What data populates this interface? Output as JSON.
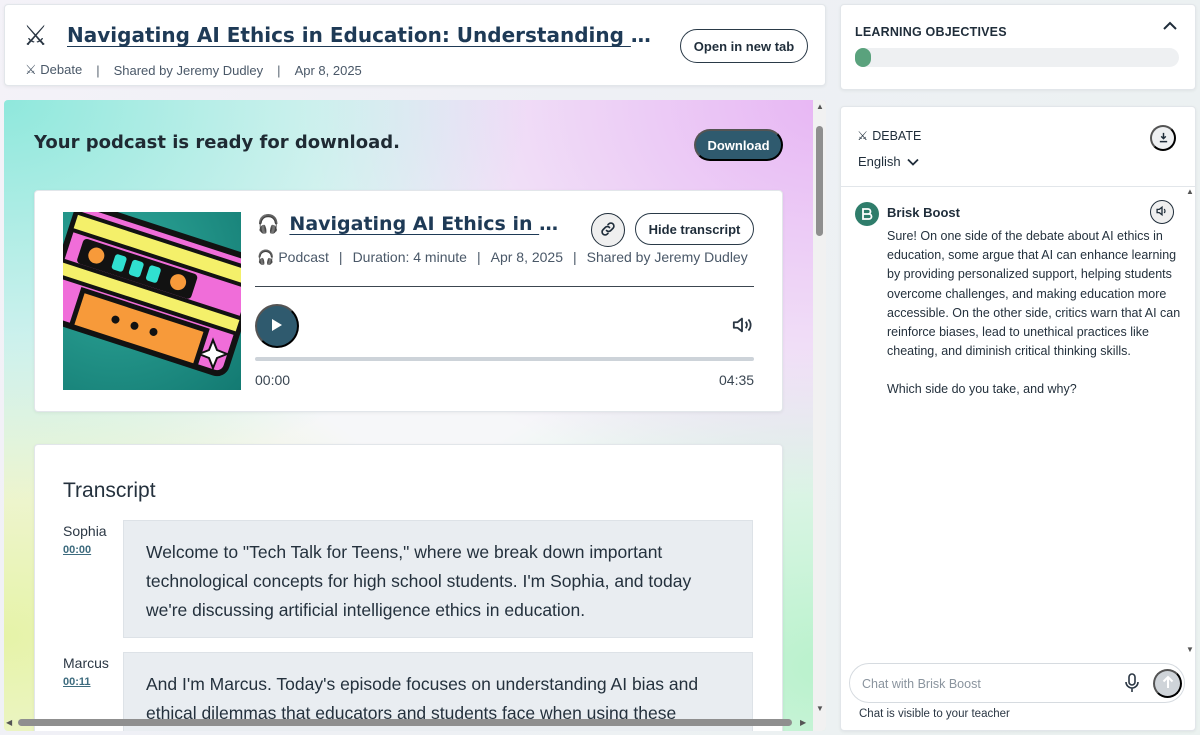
{
  "header": {
    "title": "Navigating AI Ethics in Education: Understanding Bias and Ethical Dilemmas",
    "type": "Debate",
    "shared_by": "Shared by Jeremy Dudley",
    "date": "Apr 8, 2025",
    "open_tab_label": "Open in new tab",
    "icon": "crossed-swords-icon"
  },
  "main": {
    "ready_text": "Your podcast is ready for download.",
    "download_label": "Download",
    "player": {
      "title": "Navigating AI Ethics in Education",
      "kind": "Podcast",
      "duration": "Duration: 4 minute",
      "date": "Apr 8, 2025",
      "shared_by": "Shared by Jeremy Dudley",
      "hide_transcript_label": "Hide transcript",
      "time_current": "00:00",
      "time_total": "04:35",
      "progress": 0
    },
    "transcript": {
      "heading": "Transcript",
      "entries": [
        {
          "speaker": "Sophia",
          "time": "00:00",
          "text": "Welcome to \"Tech Talk for Teens,\" where we break down important technological concepts for high school students. I'm Sophia, and today we're discussing artificial intelligence ethics in education."
        },
        {
          "speaker": "Marcus",
          "time": "00:11",
          "text": "And I'm Marcus. Today's episode focuses on understanding AI bias and ethical dilemmas that educators and students face when using these"
        }
      ]
    }
  },
  "objectives": {
    "title": "LEARNING OBJECTIVES",
    "progress": 0.05,
    "accent": "#5aa27d"
  },
  "chat": {
    "mode": "DEBATE",
    "language": "English",
    "bot_name": "Brisk Boost",
    "message_paragraphs": [
      "Sure! On one side of the debate about AI ethics in education, some argue that AI can enhance learning by providing personalized support, helping students overcome challenges, and making education more accessible. On the other side, critics warn that AI can reinforce biases, lead to unethical practices like cheating, and diminish critical thinking skills.",
      "Which side do you take, and why?"
    ],
    "input_placeholder": "Chat with Brisk Boost",
    "visibility_note": "Chat is visible to your teacher"
  }
}
